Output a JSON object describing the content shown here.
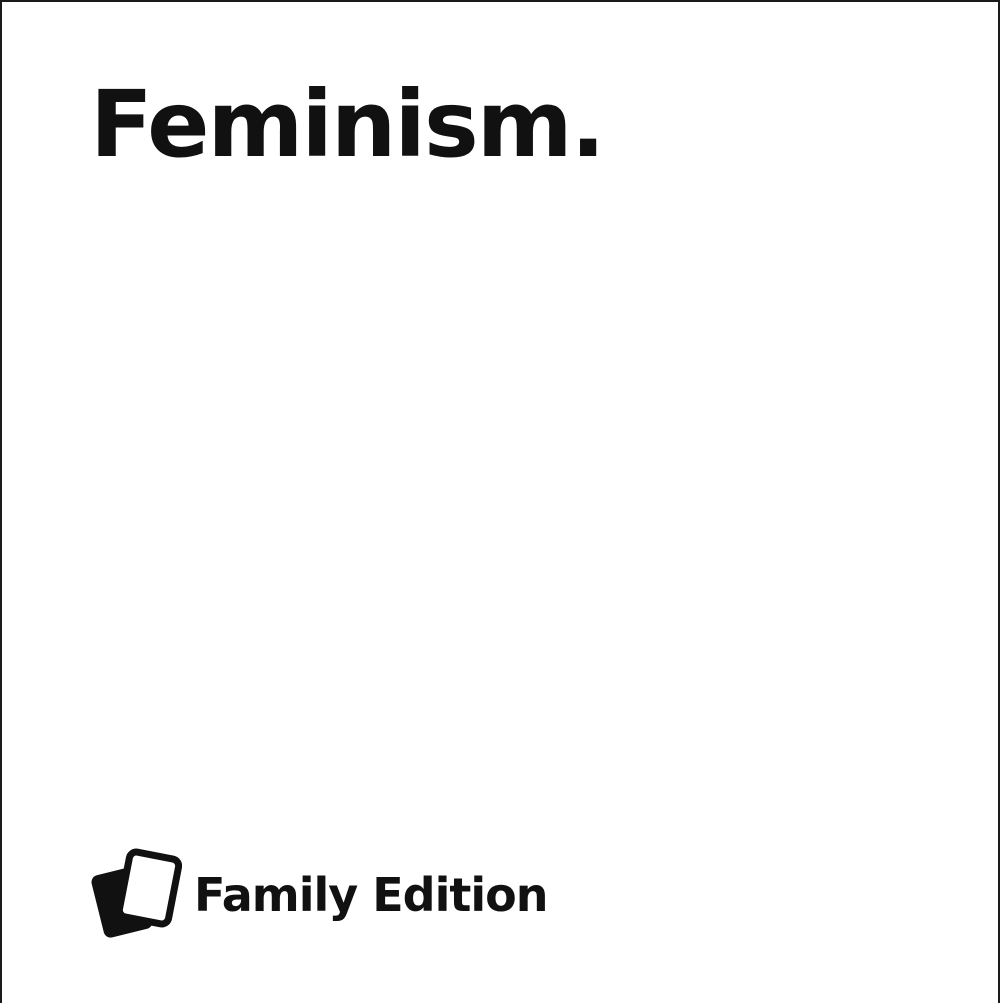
{
  "card": {
    "title": "Feminism.",
    "background_color": "#ffffff",
    "text_color": "#111111"
  },
  "brand": {
    "logo_icon": "stacked-cards-icon",
    "name": "Family Edition"
  }
}
